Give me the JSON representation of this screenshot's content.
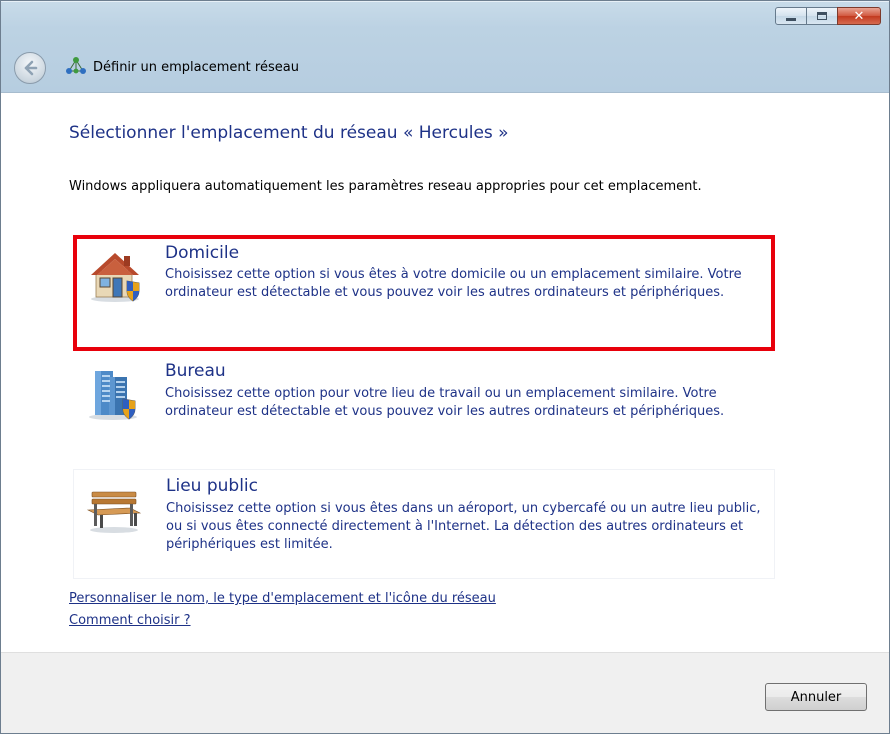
{
  "window": {
    "title": "Définir un emplacement réseau",
    "controls": {
      "close_glyph": "✕"
    }
  },
  "content": {
    "heading": "Sélectionner l'emplacement du réseau « Hercules »",
    "intro": "Windows appliquera automatiquement les paramètres reseau appropries pour cet emplacement."
  },
  "options": [
    {
      "title": "Domicile",
      "description": "Choisissez cette option si vous êtes à votre domicile ou un emplacement similaire. Votre ordinateur est détectable et vous pouvez voir les autres ordinateurs et périphériques.",
      "icon": "house-icon",
      "selected": true
    },
    {
      "title": "Bureau",
      "description": "Choisissez cette option pour votre lieu de travail ou un emplacement similaire. Votre ordinateur est détectable et vous pouvez voir les autres ordinateurs et périphériques.",
      "icon": "office-building-icon",
      "selected": false
    },
    {
      "title": "Lieu public",
      "description": "Choisissez cette option si vous êtes dans un aéroport, un cybercafé ou un autre lieu public, ou si vous êtes connecté directement à l'Internet. La détection des autres ordinateurs et périphériques est limitée.",
      "icon": "bench-icon",
      "selected": false
    }
  ],
  "links": {
    "customize": "Personnaliser le nom, le type d'emplacement et l'icône du réseau",
    "how_to_choose": "Comment choisir ?"
  },
  "footer": {
    "cancel_label": "Annuler"
  },
  "colors": {
    "link_blue": "#1e3287",
    "selection_red": "#e8000b",
    "footer_bg": "#f0f0f0"
  }
}
